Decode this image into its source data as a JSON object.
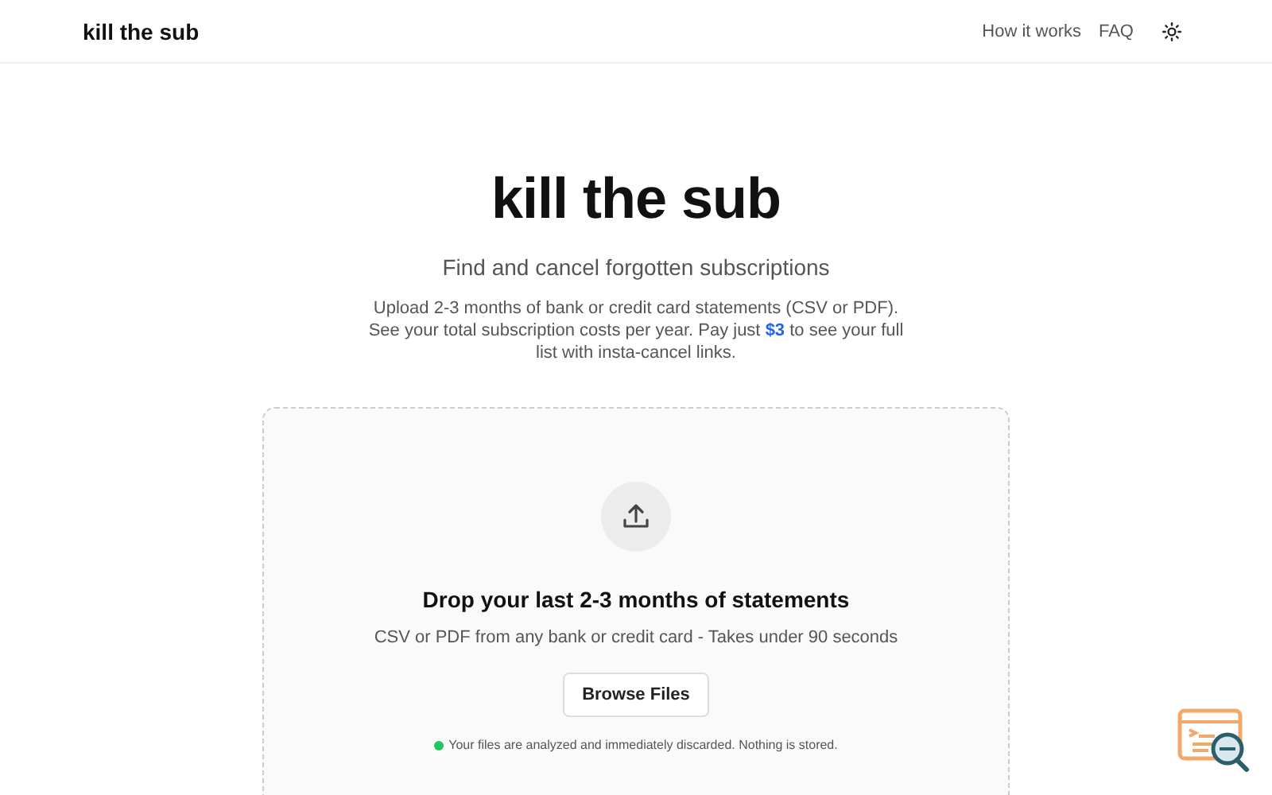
{
  "header": {
    "logo": "kill the sub",
    "nav": [
      "How it works",
      "FAQ"
    ]
  },
  "hero": {
    "title": "kill the sub",
    "subtitle": "Find and cancel forgotten subscriptions",
    "description": "Upload 2-3 months of bank or credit card statements (CSV or PDF). See your total subscription costs per year. Pay just **$3** to see your full list with insta-cancel links."
  },
  "dropzone": {
    "heading": "Drop your last 2-3 months of statements",
    "hint": "CSV or PDF from any bank or credit card - Takes under 90 seconds",
    "button": "Browse Files",
    "privacy_note": {
      "text": "Your files are analyzed and immediately discarded. Nothing is stored.",
      "color": "#22c55e"
    }
  }
}
